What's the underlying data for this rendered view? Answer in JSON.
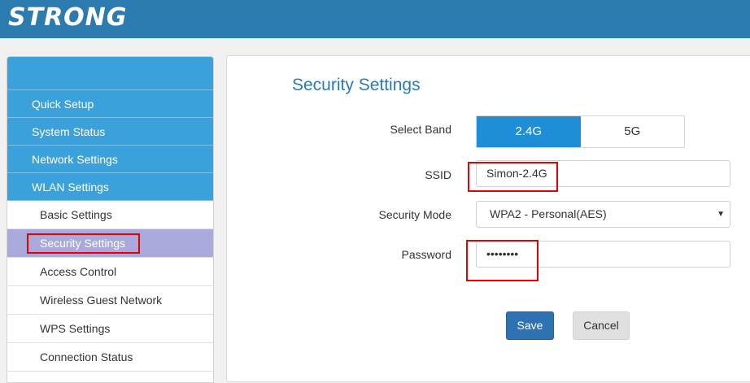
{
  "header": {
    "logo_text": "STRONG",
    "background": "#2c7bae"
  },
  "sidebar": {
    "items": [
      {
        "label": "Quick Setup"
      },
      {
        "label": "System Status"
      },
      {
        "label": "Network Settings"
      },
      {
        "label": "WLAN Settings"
      }
    ],
    "subitems": [
      {
        "label": "Basic Settings",
        "active": false
      },
      {
        "label": "Security Settings",
        "active": true
      },
      {
        "label": "Access Control",
        "active": false
      },
      {
        "label": "Wireless Guest Network",
        "active": false
      },
      {
        "label": "WPS Settings",
        "active": false
      },
      {
        "label": "Connection Status",
        "active": false
      }
    ]
  },
  "main": {
    "title": "Security Settings",
    "select_band": {
      "label": "Select Band",
      "options": [
        "2.4G",
        "5G"
      ],
      "selected": "2.4G"
    },
    "ssid": {
      "label": "SSID",
      "value": "Simon-2.4G"
    },
    "security_mode": {
      "label": "Security Mode",
      "value": "WPA2 - Personal(AES)",
      "caret": "▼"
    },
    "password": {
      "label": "Password",
      "value": "••••••••"
    },
    "save_label": "Save",
    "cancel_label": "Cancel"
  },
  "colors": {
    "accent": "#1e8fd6",
    "sidebar_blue": "#3ba1db",
    "active_item": "#a9a9db",
    "highlight": "#e60000",
    "save_button": "#2f72b2"
  }
}
